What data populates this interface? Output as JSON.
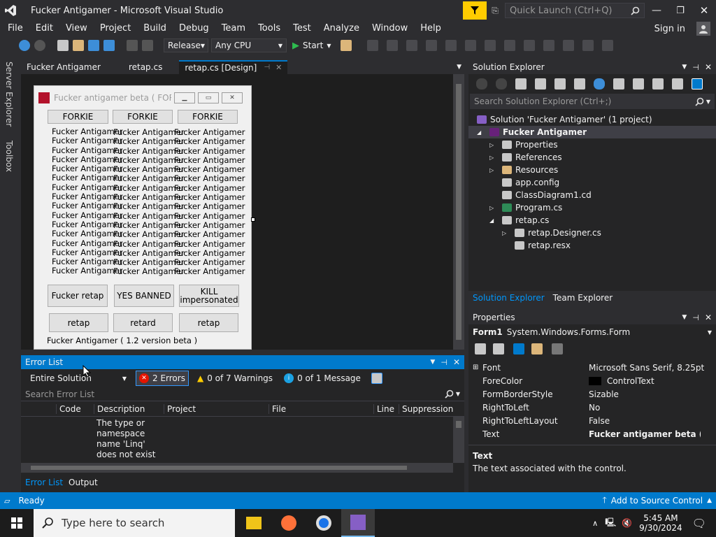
{
  "window": {
    "title": "Fucker Antigamer - Microsoft Visual Studio",
    "quick_launch_placeholder": "Quick Launch (Ctrl+Q)",
    "sign_in": "Sign in"
  },
  "menu": [
    "File",
    "Edit",
    "View",
    "Project",
    "Build",
    "Debug",
    "Team",
    "Tools",
    "Test",
    "Analyze",
    "Window",
    "Help"
  ],
  "toolbar": {
    "config": "Release",
    "platform": "Any CPU",
    "start_label": "Start"
  },
  "left_strip": [
    "Server Explorer",
    "Toolbox"
  ],
  "doc_tabs": [
    {
      "label": "Fucker Antigamer"
    },
    {
      "label": "retap.cs"
    },
    {
      "label": "retap.cs [Design]"
    }
  ],
  "form": {
    "title": "Fucker antigamer beta ( FORKI...",
    "top_buttons": [
      "FORKIE",
      "FORKIE",
      "FORKIE"
    ],
    "label_text": "Fucker Antigamer",
    "label_rows": 16,
    "mid_buttons": [
      "Fucker retap",
      "YES BANNED",
      "KILL impersonated"
    ],
    "bottom_buttons": [
      "retap",
      "retard",
      "retap"
    ],
    "footer": "Fucker Antigamer ( 1.2 version beta )"
  },
  "solution_explorer": {
    "title": "Solution Explorer",
    "search_placeholder": "Search Solution Explorer (Ctrl+;)",
    "items": [
      {
        "label": "Solution 'Fucker Antigamer' (1 project)"
      },
      {
        "label": "Fucker Antigamer"
      },
      {
        "label": "Properties"
      },
      {
        "label": "References"
      },
      {
        "label": "Resources"
      },
      {
        "label": "app.config"
      },
      {
        "label": "ClassDiagram1.cd"
      },
      {
        "label": "Program.cs"
      },
      {
        "label": "retap.cs"
      },
      {
        "label": "retap.Designer.cs"
      },
      {
        "label": "retap.resx"
      }
    ],
    "tabs": [
      "Solution Explorer",
      "Team Explorer"
    ]
  },
  "properties": {
    "title": "Properties",
    "object": "Form1",
    "object_type": "System.Windows.Forms.Form",
    "rows": [
      {
        "name": "Font",
        "value": "Microsoft Sans Serif, 8.25pt"
      },
      {
        "name": "ForeColor",
        "value": "ControlText"
      },
      {
        "name": "FormBorderStyle",
        "value": "Sizable"
      },
      {
        "name": "RightToLeft",
        "value": "No"
      },
      {
        "name": "RightToLeftLayout",
        "value": "False"
      },
      {
        "name": "Text",
        "value": "Fucker antigamer beta ( FOR"
      }
    ],
    "desc_title": "Text",
    "desc_text": "The text associated with the control."
  },
  "error_list": {
    "title": "Error List",
    "scope": "Entire Solution",
    "errors": "2 Errors",
    "warnings": "0 of 7 Warnings",
    "messages": "0 of 1 Message",
    "search_placeholder": "Search Error List",
    "columns": [
      "Code",
      "Description",
      "Project",
      "File",
      "Line",
      "Suppression S"
    ],
    "first_desc": "The type or namespace name 'Linq' does not exist in the",
    "tabs": [
      "Error List",
      "Output"
    ]
  },
  "status": {
    "ready": "Ready",
    "source_control": "Add to Source Control"
  },
  "taskbar": {
    "search_placeholder": "Type here to search",
    "time": "5:45 AM",
    "date": "9/30/2024"
  },
  "colors": {
    "accent": "#007acc",
    "vs_purple": "#865fc5"
  }
}
